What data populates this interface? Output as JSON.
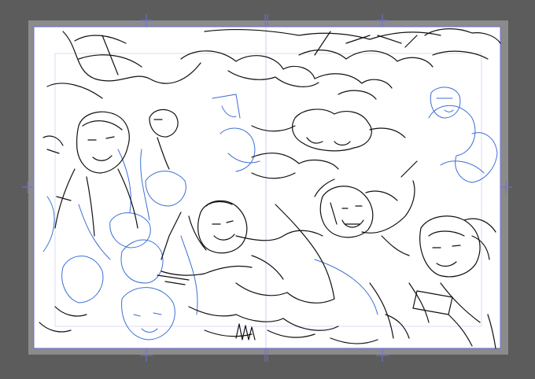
{
  "app": {
    "kind": "illustration-canvas",
    "document": {
      "background": "#ffffff",
      "workspace_background": "#5c5c5c",
      "bleed_color": "#8a8a8a",
      "guide_color": "#6f6fd8"
    },
    "layers": [
      {
        "name": "ink-sketch",
        "color": "#111111"
      },
      {
        "name": "blue-underdrawing",
        "color": "#3b6fd4"
      }
    ],
    "figures": [
      {
        "name": "character-top-left"
      },
      {
        "name": "character-reaching-center"
      },
      {
        "name": "character-laughing-center-right"
      },
      {
        "name": "character-right-holding-object"
      },
      {
        "name": "character-bottom-left-blue"
      },
      {
        "name": "character-top-right-blue"
      }
    ]
  }
}
